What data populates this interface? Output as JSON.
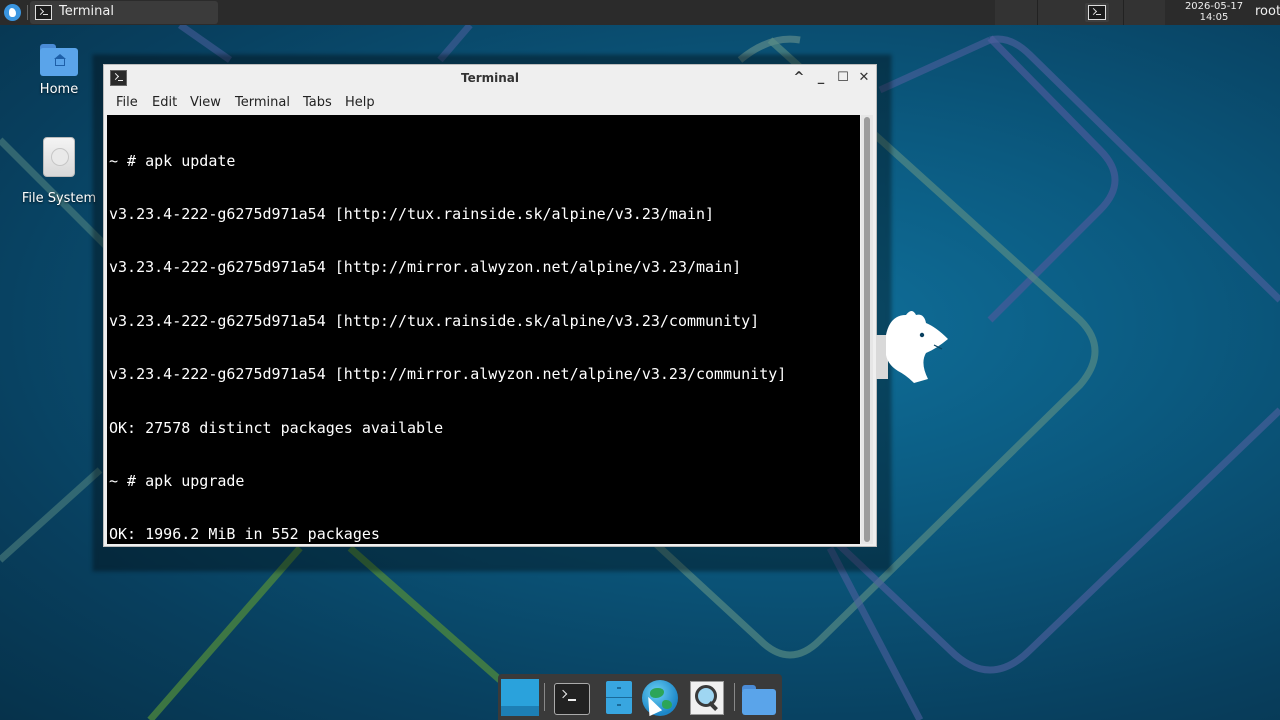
{
  "colors": {
    "desktop_bg": "#0b5a80",
    "panel_bg": "#2b2b2b",
    "terminal_bg": "#000000",
    "terminal_fg": "#ffffff",
    "window_chrome": "#efefef"
  },
  "top_panel": {
    "task_label": "Terminal",
    "clock_date": "2026-05-17",
    "clock_time": "14:05",
    "user": "root"
  },
  "desktop_icons": [
    {
      "label": "Home",
      "icon": "home-folder-icon"
    },
    {
      "label": "File System",
      "icon": "drive-icon"
    }
  ],
  "window": {
    "title": "Terminal",
    "controls": {
      "shade": "^",
      "minimize": "_",
      "maximize": "☐",
      "close": "✕"
    },
    "menu": [
      "File",
      "Edit",
      "View",
      "Terminal",
      "Tabs",
      "Help"
    ],
    "lines": [
      "~ # apk update",
      "v3.23.4-222-g6275d971a54 [http://tux.rainside.sk/alpine/v3.23/main]",
      "v3.23.4-222-g6275d971a54 [http://mirror.alwyzon.net/alpine/v3.23/main]",
      "v3.23.4-222-g6275d971a54 [http://tux.rainside.sk/alpine/v3.23/community]",
      "v3.23.4-222-g6275d971a54 [http://mirror.alwyzon.net/alpine/v3.23/community]",
      "OK: 27578 distinct packages available",
      "~ # apk upgrade",
      "OK: 1996.2 MiB in 552 packages"
    ],
    "prompt": "~ # "
  },
  "dock": {
    "items": [
      "desktop-icon",
      "terminal-icon",
      "file-cabinet-icon",
      "web-browser-icon",
      "search-icon",
      "folder-icon"
    ]
  }
}
